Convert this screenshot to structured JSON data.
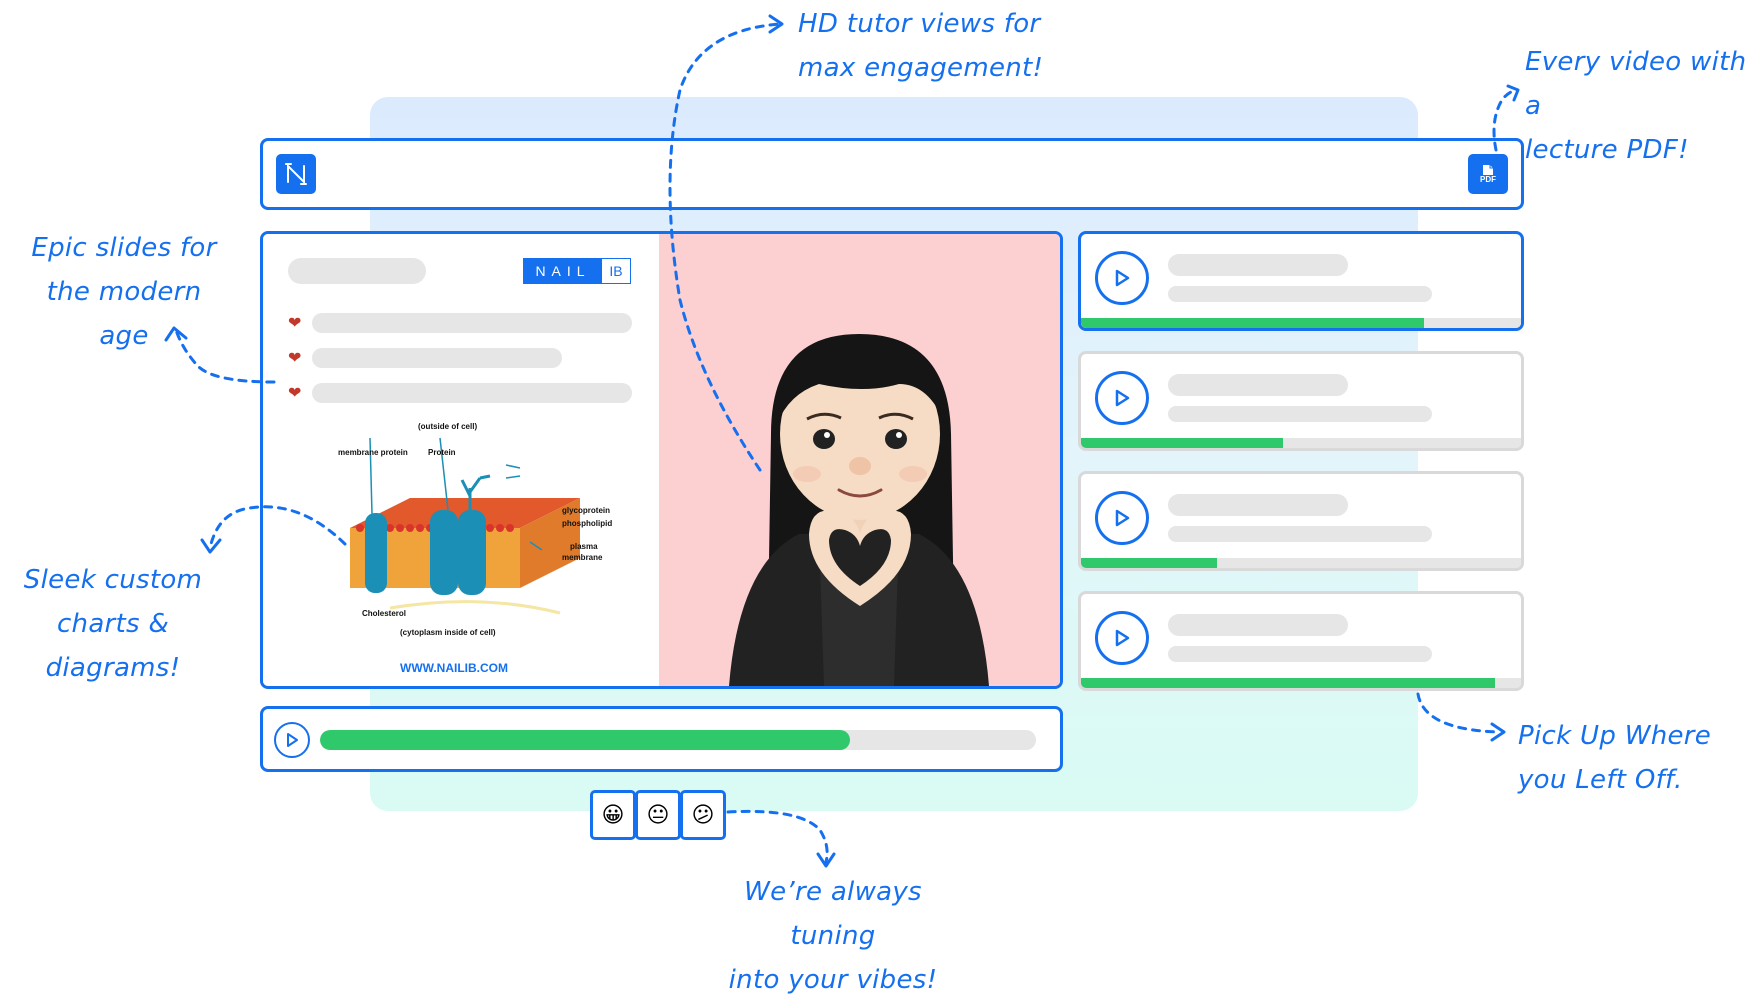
{
  "annotations": {
    "tutor": [
      "HD tutor views for",
      "max engagement!"
    ],
    "pdf": [
      "Every video with a",
      "lecture PDF!"
    ],
    "slides": [
      "Epic slides for",
      "the modern age"
    ],
    "charts": [
      "Sleek custom",
      "charts & diagrams!"
    ],
    "resume": [
      "Pick Up Where",
      "you Left Off."
    ],
    "vibes": [
      "We’re always tuning",
      "into your vibes!"
    ]
  },
  "toolbar": {
    "pdf_label": "PDF"
  },
  "slide": {
    "brand_left": "NAIL",
    "brand_right": "IB",
    "diagram_labels": {
      "outside": "(outside of cell)",
      "membrane_protein": "membrane protein",
      "protein": "Protein",
      "glycoprotein": "glycoprotein",
      "phospholipid": "phospholipid",
      "plasma": "plasma",
      "membrane": "membrane",
      "cholesterol": "Cholesterol",
      "cytoplasm": "(cytoplasm inside of cell)"
    },
    "website": "WWW.NAILIB.COM"
  },
  "player": {
    "progress": 0.74
  },
  "playlist": [
    {
      "progress": 0.78,
      "active": true
    },
    {
      "progress": 0.46,
      "active": false
    },
    {
      "progress": 0.31,
      "active": false
    },
    {
      "progress": 0.94,
      "active": false
    }
  ],
  "feedback": [
    "😀",
    "😐",
    "😕"
  ],
  "colors": {
    "accent": "#1570ef",
    "progress": "#2fc96b",
    "tutor_bg": "#fccfd1"
  }
}
